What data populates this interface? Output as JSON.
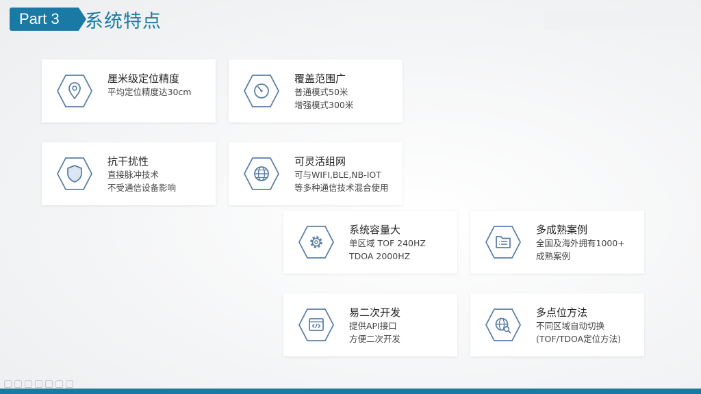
{
  "header": {
    "part_label": "Part 3",
    "title": "系统特点"
  },
  "colors": {
    "accent": "#1b7aa3",
    "icon_stroke": "#5a7fa8",
    "card_bg": "#ffffff"
  },
  "features": [
    {
      "icon": "location-pin-icon",
      "title": "厘米级定位精度",
      "lines": [
        "平均定位精度达30cm",
        ""
      ]
    },
    {
      "icon": "gauge-icon",
      "title": "覆盖范围广",
      "lines": [
        "普通模式50米",
        "增强模式300米"
      ]
    },
    {
      "icon": "shield-icon",
      "title": "抗干扰性",
      "lines": [
        "直接脉冲技术",
        "不受通信设备影响"
      ]
    },
    {
      "icon": "globe-icon",
      "title": "可灵活组网",
      "lines": [
        "可与WIFI,BLE,NB-IOT",
        "等多种通信技术混合使用"
      ]
    },
    {
      "icon": "gear-icon",
      "title": "系统容量大",
      "lines": [
        "单区域 TOF 240HZ",
        "TDOA 2000HZ"
      ]
    },
    {
      "icon": "folder-list-icon",
      "title": "多成熟案例",
      "lines": [
        "全国及海外拥有1000+",
        "成熟案例"
      ]
    },
    {
      "icon": "code-window-icon",
      "title": "易二次开发",
      "lines": [
        "提供API接口",
        "方便二次开发"
      ]
    },
    {
      "icon": "globe-search-icon",
      "title": "多点位方法",
      "lines": [
        "不同区域自动切换",
        "(TOF/TDOA定位方法)"
      ]
    }
  ]
}
